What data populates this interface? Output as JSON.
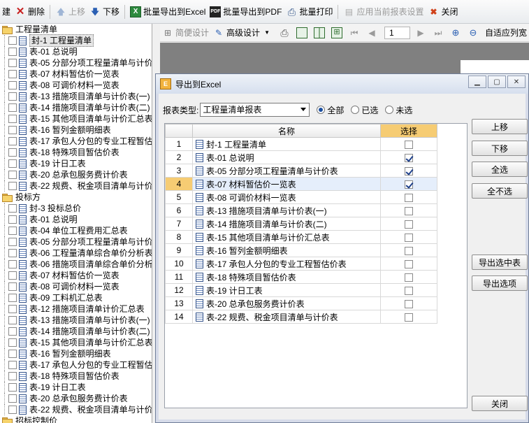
{
  "toolbar": {
    "items": [
      {
        "label": "建",
        "icon": "new-icon"
      },
      {
        "label": "删除",
        "icon": "delete-x-icon"
      },
      {
        "label": "上移",
        "icon": "up-arrow-icon",
        "disabled": true
      },
      {
        "label": "下移",
        "icon": "down-arrow-icon"
      },
      {
        "label": "批量导出到Excel",
        "icon": "excel-icon"
      },
      {
        "label": "批量导出到PDF",
        "icon": "pdf-icon"
      },
      {
        "label": "批量打印",
        "icon": "print-icon"
      },
      {
        "label": "应用当前报表设置",
        "icon": "apply-settings-icon",
        "disabled": true
      },
      {
        "label": "关闭",
        "icon": "close-icon"
      }
    ]
  },
  "tree": {
    "groups": [
      {
        "label": "工程量清单",
        "items": [
          "封-1 工程量清单",
          "表-01 总说明",
          "表-05 分部分项工程量清单与计价表",
          "表-07 材料暂估价一览表",
          "表-08 可调价材料一览表",
          "表-13 措施项目清单与计价表(一)",
          "表-14 措施项目清单与计价表(二)",
          "表-15 其他项目清单与计价汇总表",
          "表-16 暂列金额明细表",
          "表-17 承包人分包的专业工程暂估价表",
          "表-18 特殊项目暂估价表",
          "表-19 计日工表",
          "表-20 总承包服务费计价表",
          "表-22 规费、税金项目清单与计价表"
        ]
      },
      {
        "label": "投标方",
        "items": [
          "封-3 投标总价",
          "表-01 总说明",
          "表-04 单位工程费用汇总表",
          "表-05 分部分项工程量清单与计价表",
          "表-06 工程量清单综合单价分析表",
          "表-06 措施项目清单综合单价分析表",
          "表-07 材料暂估价一览表",
          "表-08 可调价材料一览表",
          "表-09 工料机汇总表",
          "表-12 措施项目清单计价汇总表",
          "表-13 措施项目清单与计价表(一)",
          "表-14 措施项目清单与计价表(二)",
          "表-15 其他项目清单与计价汇总表",
          "表-16 暂列金额明细表",
          "表-17 承包人分包的专业工程暂估价表",
          "表-18 特殊项目暂估价表",
          "表-19 计日工表",
          "表-20 总承包服务费计价表",
          "表-22 规费、税金项目清单与计价表"
        ]
      },
      {
        "label": "招标控制价",
        "items": []
      }
    ]
  },
  "report_toolbar": {
    "simple_design": "简便设计",
    "advanced_design": "高级设计",
    "page_number": "1",
    "fit_width": "自适应列宽"
  },
  "dialog": {
    "title": "导出到Excel",
    "report_type_label": "报表类型:",
    "report_type_value": "工程量清单报表",
    "radio_all": "全部",
    "radio_selected": "已选",
    "radio_unselected": "未选",
    "columns": {
      "name": "名称",
      "pick": "选择"
    },
    "rows": [
      {
        "num": "1",
        "name": "封-1 工程量清单",
        "checked": false
      },
      {
        "num": "2",
        "name": "表-01 总说明",
        "checked": true
      },
      {
        "num": "3",
        "name": "表-05 分部分项工程量清单与计价表",
        "checked": true
      },
      {
        "num": "4",
        "name": "表-07 材料暂估价一览表",
        "checked": true
      },
      {
        "num": "5",
        "name": "表-08 可调价材料一览表",
        "checked": false
      },
      {
        "num": "6",
        "name": "表-13 措施项目清单与计价表(一)",
        "checked": false
      },
      {
        "num": "7",
        "name": "表-14 措施项目清单与计价表(二)",
        "checked": false
      },
      {
        "num": "8",
        "name": "表-15 其他项目清单与计价汇总表",
        "checked": false
      },
      {
        "num": "9",
        "name": "表-16 暂列金额明细表",
        "checked": false
      },
      {
        "num": "10",
        "name": "表-17 承包人分包的专业工程暂估价表",
        "checked": false
      },
      {
        "num": "11",
        "name": "表-18 特殊项目暂估价表",
        "checked": false
      },
      {
        "num": "12",
        "name": "表-19 计日工表",
        "checked": false
      },
      {
        "num": "13",
        "name": "表-20 总承包服务费计价表",
        "checked": false
      },
      {
        "num": "14",
        "name": "表-22 规费、税金项目清单与计价表",
        "checked": false
      }
    ],
    "buttons": {
      "move_up": "上移",
      "move_down": "下移",
      "select_all": "全选",
      "select_none": "全不选",
      "export_selected_table": "导出选中表",
      "export_selected_items": "导出选项",
      "close": "关闭"
    }
  }
}
